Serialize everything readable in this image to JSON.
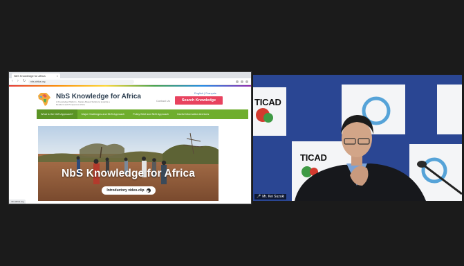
{
  "browser": {
    "tab_title": "NbS Knowledge for Africa",
    "url": "nbs-africa.org"
  },
  "site": {
    "title": "NbS Knowledge for Africa",
    "subtitle": "A Knowledge Platform - Nature-Based Solutions towards a Resilient and Prosperous Africa",
    "contact_label": "Contact Us",
    "language_links": "English | Français",
    "search_button": "Search Knowledge",
    "nav": [
      {
        "label": "What is the NbS Approach?",
        "active": true
      },
      {
        "label": "Major Challenges and NbS Approach",
        "active": false
      },
      {
        "label": "Policy Brief and NbS Approach",
        "active": false
      },
      {
        "label": "Useful Information Archives",
        "active": false
      }
    ],
    "hero_title": "NbS Knowledge for Africa",
    "video_button": "Introductory video-clip"
  },
  "camera": {
    "backdrop_text_1": "TICAD",
    "backdrop_text_2": "TICAD",
    "participant_name": "Mr. Kei Suzuki"
  },
  "colors": {
    "nav_green": "#6fae2e",
    "search_pink": "#e8435f",
    "backdrop_blue": "#27428e"
  }
}
